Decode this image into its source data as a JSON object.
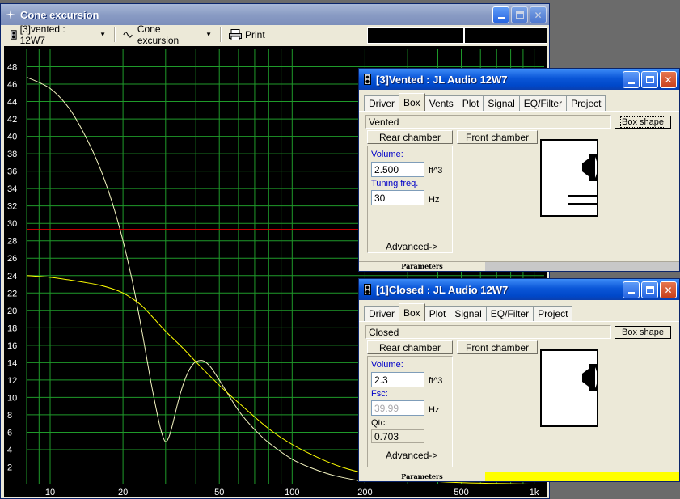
{
  "main_window": {
    "title": "Cone excursion",
    "toolbar": {
      "project_dropdown": "[3]vented : 12W7",
      "graph_dropdown": "Cone excursion",
      "print_label": "Print"
    }
  },
  "chart_data": {
    "type": "line",
    "xscale": "log",
    "xlim": [
      8,
      1100
    ],
    "ylim": [
      0,
      50
    ],
    "x_ticks": [
      "10",
      "20",
      "50",
      "100",
      "200",
      "500",
      "1k"
    ],
    "y_ticks": [
      2,
      4,
      6,
      8,
      10,
      12,
      14,
      16,
      18,
      20,
      22,
      24,
      26,
      28,
      30,
      32,
      34,
      36,
      38,
      40,
      42,
      44,
      46,
      48
    ],
    "grid": true,
    "reference_line": {
      "y": 29.3,
      "color": "#e00000"
    },
    "series": [
      {
        "color": "#f4f4c0",
        "x": [
          8,
          10,
          12,
          14,
          16,
          18,
          20,
          22,
          24,
          26,
          28,
          29,
          30,
          31,
          32,
          34,
          36,
          38,
          40,
          43,
          46,
          50,
          60,
          70,
          80,
          100,
          120,
          150,
          200
        ],
        "y": [
          46.8,
          45.5,
          43.2,
          40.0,
          36.5,
          32.5,
          28.0,
          23.0,
          17.5,
          12.0,
          7.5,
          5.8,
          4.9,
          5.5,
          6.8,
          9.8,
          12.0,
          13.4,
          14.1,
          14.2,
          13.5,
          12.0,
          8.5,
          6.3,
          4.8,
          2.9,
          1.9,
          1.0,
          0.3
        ]
      },
      {
        "color": "#ffff00",
        "x": [
          8,
          10,
          12,
          14,
          16,
          18,
          20,
          22,
          24,
          27,
          30,
          35,
          40,
          50,
          60,
          80,
          100,
          130,
          160,
          200,
          300,
          500,
          1000
        ],
        "y": [
          24.0,
          23.8,
          23.5,
          23.2,
          22.9,
          22.5,
          22.0,
          21.3,
          20.5,
          19.0,
          17.6,
          15.8,
          14.1,
          11.4,
          9.4,
          6.4,
          4.6,
          3.0,
          2.0,
          1.3,
          0.6,
          0.2,
          0.05
        ]
      }
    ]
  },
  "vented_dialog": {
    "title": "[3]Vented : JL Audio 12W7",
    "tabs": [
      "Driver",
      "Box",
      "Vents",
      "Plot",
      "Signal",
      "EQ/Filter",
      "Project"
    ],
    "active_tab": "Box",
    "box_type": "Vented",
    "box_shape_button": "Box shape",
    "rear_chamber": "Rear chamber",
    "front_chamber": "Front chamber",
    "volume_label": "Volume:",
    "volume_value": "2.500",
    "volume_unit": "ft^3",
    "tuning_label": "Tuning freq.",
    "tuning_value": "30",
    "tuning_unit": "Hz",
    "advanced": "Advanced->",
    "status_label": "Parameters",
    "status_bar_color": "#c8c8c8"
  },
  "closed_dialog": {
    "title": "[1]Closed : JL Audio 12W7",
    "tabs": [
      "Driver",
      "Box",
      "Plot",
      "Signal",
      "EQ/Filter",
      "Project"
    ],
    "active_tab": "Box",
    "box_type": "Closed",
    "box_shape_button": "Box shape",
    "rear_chamber": "Rear chamber",
    "front_chamber": "Front chamber",
    "volume_label": "Volume:",
    "volume_value": "2.3",
    "volume_unit": "ft^3",
    "fsc_label": "Fsc:",
    "fsc_value": "39.99",
    "fsc_unit": "Hz",
    "qtc_label": "Qtc:",
    "qtc_value": "0.703",
    "advanced": "Advanced->",
    "status_label": "Parameters",
    "status_bar_color": "#ffff00"
  }
}
